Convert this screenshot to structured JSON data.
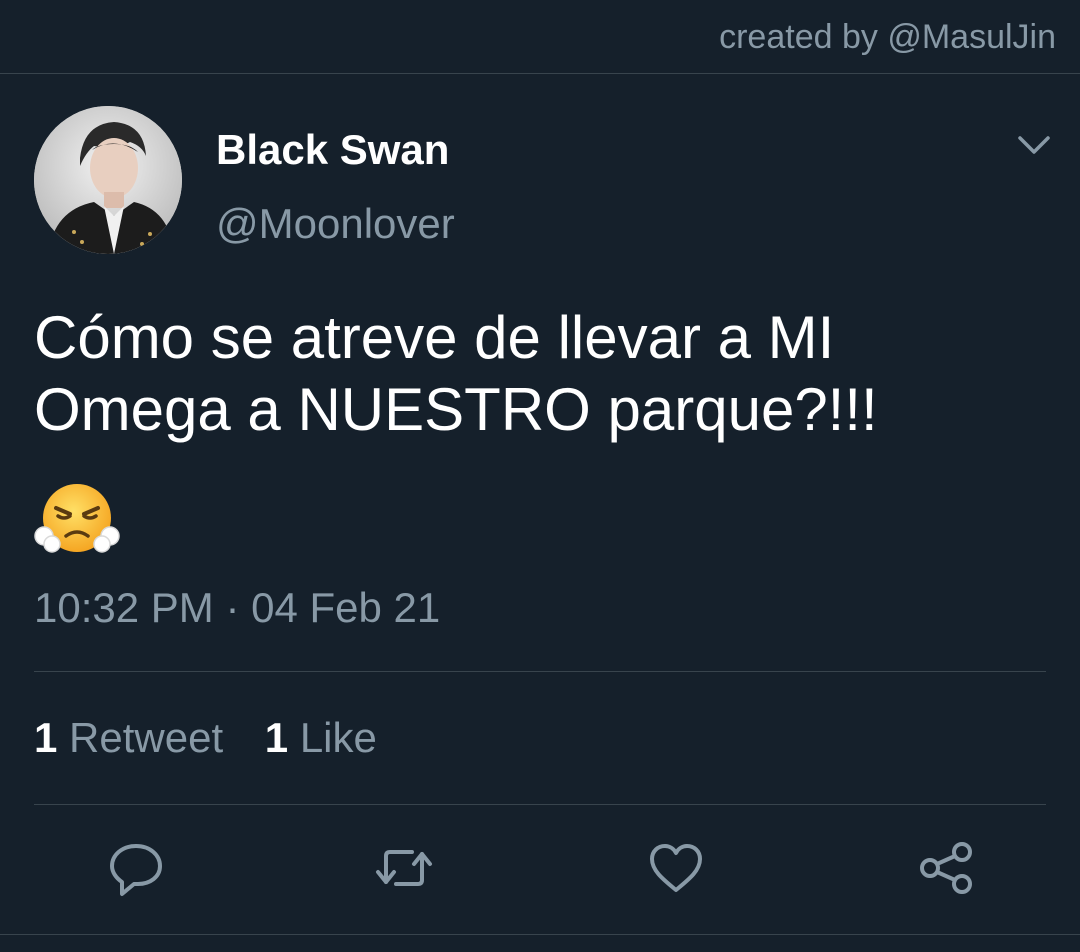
{
  "watermark": "created by @MasulJin",
  "user": {
    "display_name": "Black Swan",
    "handle": "@Moonlover"
  },
  "tweet": {
    "text_line1": "Cómo se atreve de llevar a MI",
    "text_line2": "Omega a NUESTRO parque?!!!",
    "emoji": "face-with-steam-from-nose",
    "timestamp": "10:32 PM · 04 Feb 21"
  },
  "stats": {
    "retweets_count": "1",
    "retweets_label": "Retweet",
    "likes_count": "1",
    "likes_label": "Like"
  },
  "actions": [
    "reply-icon",
    "retweet-icon",
    "like-icon",
    "share-icon"
  ],
  "colors": {
    "background": "#15202b",
    "secondary_text": "#8899a6",
    "divider": "#38444d",
    "primary_text": "#ffffff"
  }
}
